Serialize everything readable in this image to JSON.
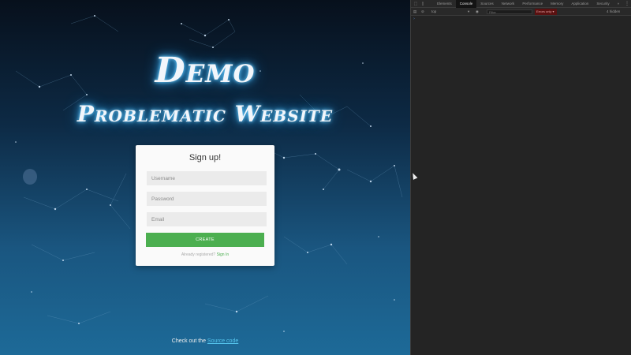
{
  "site": {
    "heading": "Demo",
    "subheading": "Problematic Website",
    "form": {
      "title": "Sign up!",
      "username_placeholder": "Username",
      "password_placeholder": "Password",
      "email_placeholder": "Email",
      "create_label": "CREATE",
      "already_text": "Already registered?",
      "signin_label": "Sign In"
    },
    "footer": {
      "text": "Check out the",
      "link_label": "Source code"
    }
  },
  "devtools": {
    "tabs": [
      "Elements",
      "Console",
      "Sources",
      "Network",
      "Performance",
      "Memory",
      "Application",
      "Security"
    ],
    "active_tab": "Console",
    "more_tabs": "»",
    "context": "top",
    "filter_placeholder": "Filter",
    "level_label": "Errors only ▾",
    "hidden_label": "4 hidden",
    "colors": {
      "bg": "#242424",
      "active_tab": "#141414",
      "errors_badge": "#5a1111"
    }
  }
}
